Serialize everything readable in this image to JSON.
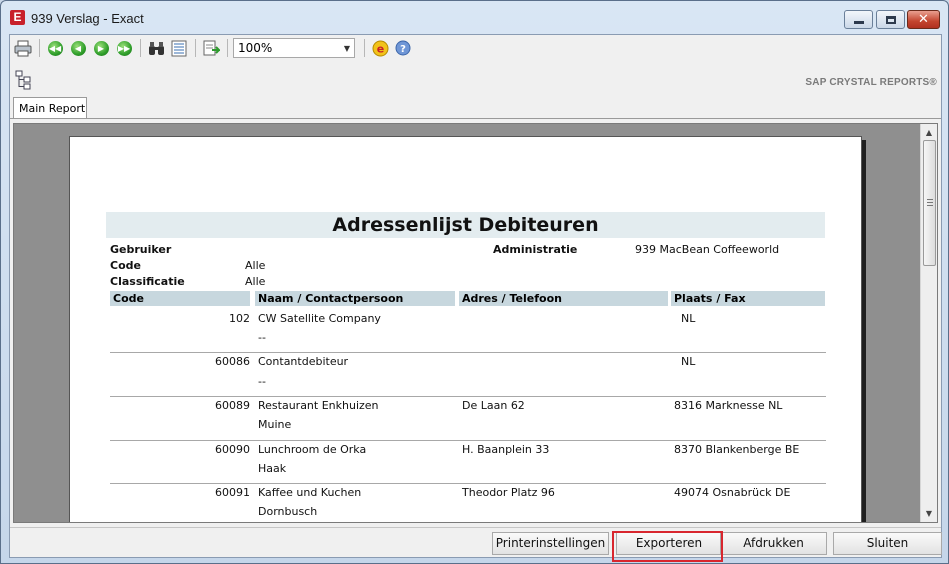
{
  "window": {
    "icon_letter": "E",
    "title": "939 Verslag - Exact"
  },
  "toolbar": {
    "zoom_value": "100%",
    "icons": [
      "printer-icon",
      "first-page-icon",
      "previous-page-icon",
      "next-page-icon",
      "last-page-icon",
      "find-icon",
      "group-tree-icon",
      "export-icon",
      "exact-icon",
      "help-icon"
    ]
  },
  "viewer": {
    "brand": "SAP CRYSTAL REPORTS®",
    "tab_label": "Main Report"
  },
  "report": {
    "title": "Adressenlijst Debiteuren",
    "params": {
      "gebruiker_label": "Gebruiker",
      "code_label": "Code",
      "code_value": "Alle",
      "classificatie_label": "Classificatie",
      "classificatie_value": "Alle",
      "administratie_label": "Administratie",
      "administratie_value": "939 MacBean Coffeeworld"
    },
    "columns": [
      "Code",
      "Naam / Contactpersoon",
      "Adres / Telefoon",
      "Plaats / Fax"
    ],
    "rows": [
      {
        "code": "102",
        "naam": "CW Satellite Company",
        "contact": "--",
        "adres": "",
        "plaats": "NL"
      },
      {
        "code": "60086",
        "naam": "Contantdebiteur",
        "contact": "--",
        "adres": "",
        "plaats": "NL"
      },
      {
        "code": "60089",
        "naam": "Restaurant Enkhuizen",
        "contact": "Muine",
        "adres": "De Laan 62",
        "plaats": "8316 Marknesse NL"
      },
      {
        "code": "60090",
        "naam": "Lunchroom de Orka",
        "contact": "Haak",
        "adres": "H. Baanplein 33",
        "plaats": "8370 Blankenberge BE"
      },
      {
        "code": "60091",
        "naam": "Kaffee und Kuchen",
        "contact": "Dornbusch",
        "adres": "Theodor Platz 96",
        "plaats": "49074 Osnabrück DE"
      }
    ]
  },
  "buttons": {
    "printer_settings": "Printerinstellingen",
    "export": "Exporteren",
    "print": "Afdrukken",
    "close": "Sluiten"
  },
  "colors": {
    "title_band": "#e3ecef",
    "column_header": "#c7d7de",
    "highlight": "#d8262e"
  }
}
